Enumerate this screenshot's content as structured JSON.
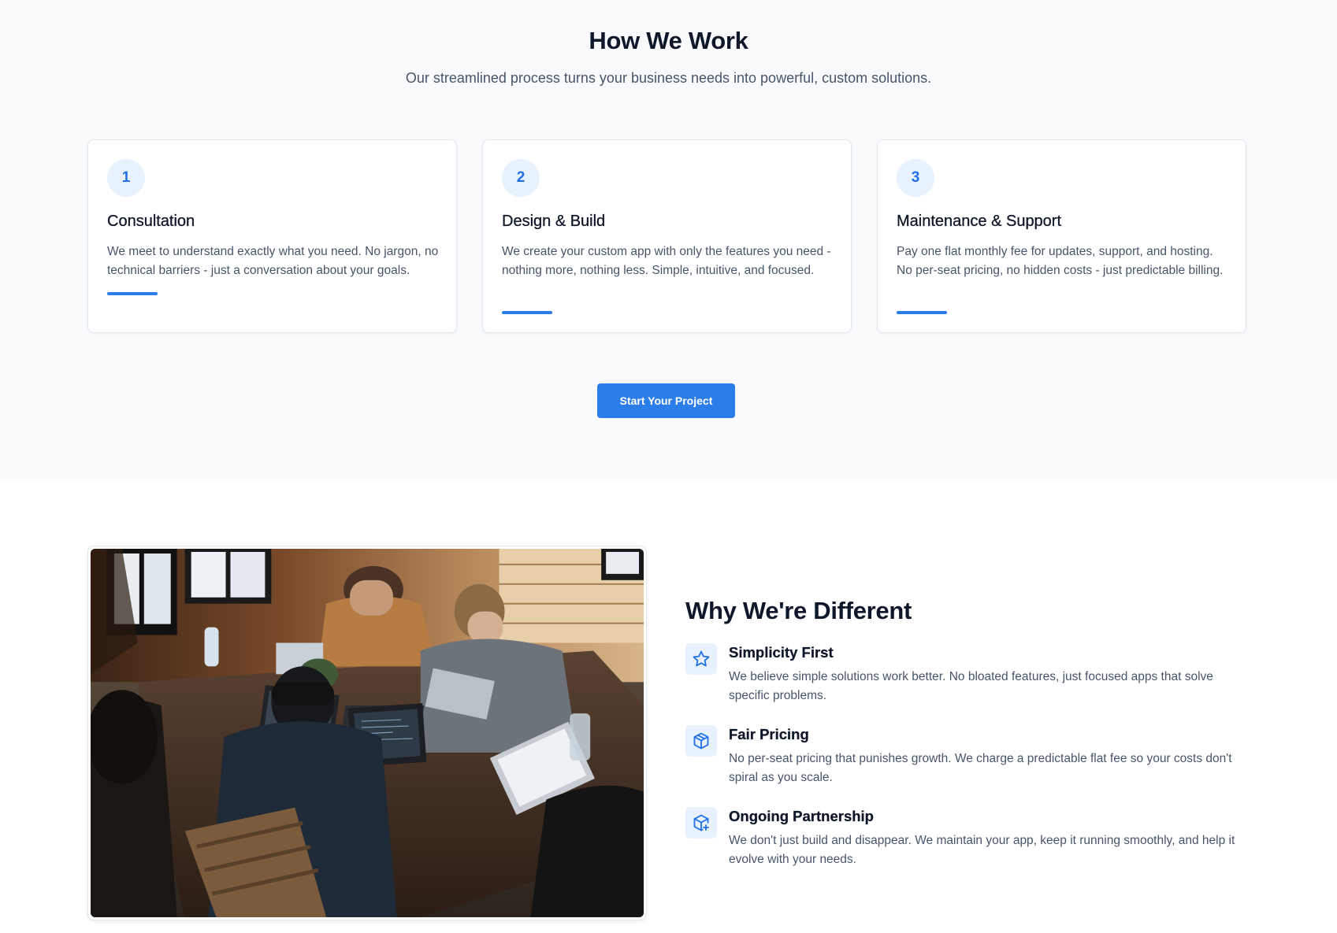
{
  "how_we_work": {
    "title": "How We Work",
    "subtitle": "Our streamlined process turns your business needs into powerful, custom solutions.",
    "steps": [
      {
        "number": "1",
        "title": "Consultation",
        "description": "We meet to understand exactly what you need. No jargon, no technical barriers - just a conversation about your goals."
      },
      {
        "number": "2",
        "title": "Design & Build",
        "description": "We create your custom app with only the features you need - nothing more, nothing less. Simple, intuitive, and focused."
      },
      {
        "number": "3",
        "title": "Maintenance & Support",
        "description": "Pay one flat monthly fee for updates, support, and hosting. No per-seat pricing, no hidden costs - just predictable billing."
      }
    ],
    "cta_label": "Start Your Project"
  },
  "why_different": {
    "title": "Why We're Different",
    "features": [
      {
        "icon": "star-icon",
        "title": "Simplicity First",
        "description": "We believe simple solutions work better. No bloated features, just focused apps that solve specific problems."
      },
      {
        "icon": "box-icon",
        "title": "Fair Pricing",
        "description": "No per-seat pricing that punishes growth. We charge a predictable flat fee so your costs don't spiral as you scale."
      },
      {
        "icon": "box-plus-icon",
        "title": "Ongoing Partnership",
        "description": "We don't just build and disappear. We maintain your app, keep it running smoothly, and help it evolve with your needs."
      }
    ]
  },
  "colors": {
    "accent": "#2b7de9",
    "accent_light": "#e8f1fe",
    "heading": "#0f172a",
    "body_text": "#475569",
    "section_bg": "#f8fafc"
  }
}
